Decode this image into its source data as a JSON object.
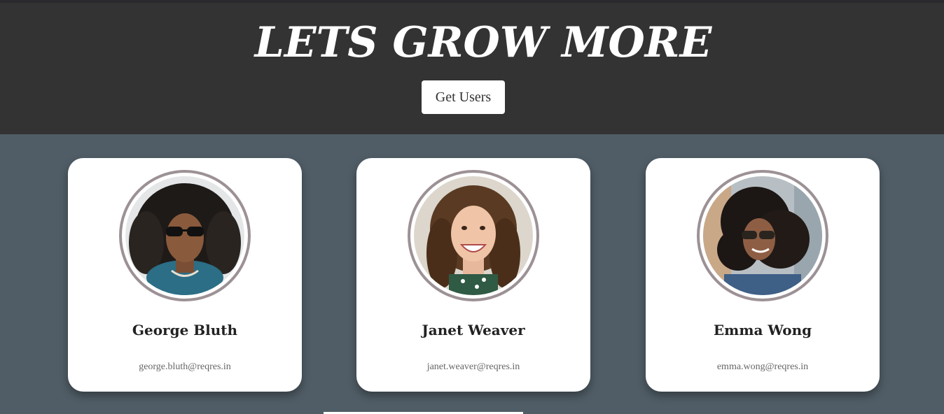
{
  "header": {
    "title": "LETS GROW MORE",
    "button_label": "Get Users"
  },
  "users": [
    {
      "name": "George Bluth",
      "email": "george.bluth@reqres.in"
    },
    {
      "name": "Janet Weaver",
      "email": "janet.weaver@reqres.in"
    },
    {
      "name": "Emma Wong",
      "email": "emma.wong@reqres.in"
    }
  ],
  "colors": {
    "header_bg": "#333333",
    "page_bg": "#505d66",
    "card_bg": "#ffffff",
    "avatar_ring": "#9c9195"
  }
}
